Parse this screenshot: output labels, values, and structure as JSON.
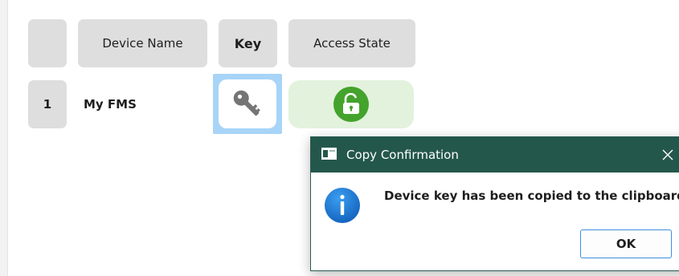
{
  "table": {
    "headers": {
      "index": "",
      "device_name": "Device Name",
      "key": "Key",
      "access_state": "Access State"
    },
    "rows": [
      {
        "index": "1",
        "device_name": "My FMS",
        "key_icon": "key-icon",
        "access_state_icon": "unlocked-padlock-icon"
      }
    ]
  },
  "dialog": {
    "title": "Copy Confirmation",
    "message": "Device key has been copied to the clipboard.",
    "ok_label": "OK",
    "icon": "info-icon",
    "close_icon": "close-icon"
  },
  "colors": {
    "header_bg": "#dedede",
    "key_highlight": "#a7d4f7",
    "access_granted_bg": "#e3f2dd",
    "access_granted_icon": "#44a32c",
    "dialog_titlebar": "#24574c",
    "info_icon": "#1f7fd6",
    "ok_border": "#3f8ede"
  }
}
